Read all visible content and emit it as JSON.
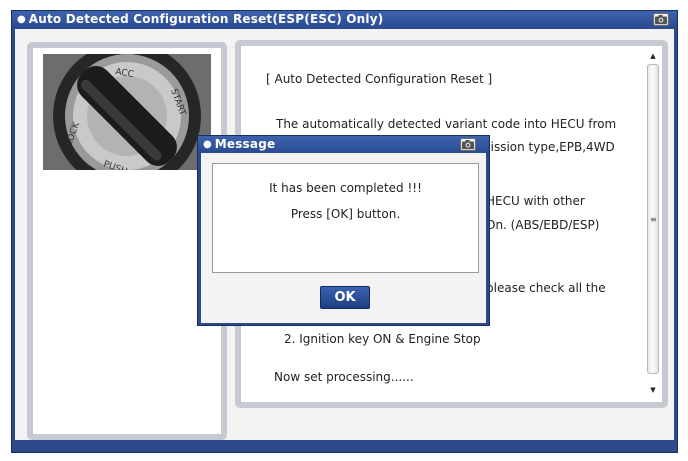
{
  "window": {
    "title": "Auto Detected Configuration Reset(ESP(ESC) Only)"
  },
  "info": {
    "lines": [
      "[ Auto Detected Configuration Reset ]",
      "The automatically detected variant code into HECU from",
      "nission type,EPB,4WD",
      "HECU with other",
      "On. (ABS/EBD/ESP)",
      "please check all the",
      "2. Ignition key ON & Engine Stop",
      "Now set processing......"
    ]
  },
  "key_photo": {
    "labels": [
      "LOCK",
      "ACC",
      "START",
      "PUSH"
    ]
  },
  "dialog": {
    "title": "Message",
    "message_line1": "It has been completed !!!",
    "message_line2": "Press [OK] button.",
    "ok_label": "OK"
  },
  "colors": {
    "titlebar": "#2c4a8a",
    "panel_border": "#c7c9d2",
    "ok_button": "#2a4f9a"
  }
}
